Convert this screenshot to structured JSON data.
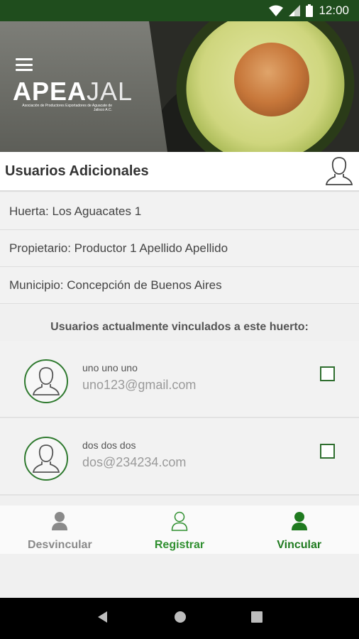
{
  "status_bar": {
    "time": "12:00"
  },
  "header": {
    "logo_main": "APEA",
    "logo_accent": "JAL",
    "logo_subtitle": "Asociación de Productores Exportadores de Aguacate de Jalisco A.C."
  },
  "title_bar": {
    "title": "Usuarios Adicionales"
  },
  "info": {
    "huerta": "Huerta: Los Aguacates 1",
    "propietario": "Propietario: Productor 1 Apellido Apellido",
    "municipio": "Municipio: Concepción de Buenos Aires"
  },
  "linked_users": {
    "label": "Usuarios actualmente vinculados a este huerto:",
    "items": [
      {
        "name": "uno uno uno",
        "email": "uno123@gmail.com",
        "checked": false
      },
      {
        "name": "dos dos dos",
        "email": "dos@234234.com",
        "checked": false
      }
    ]
  },
  "bottom_nav": {
    "items": [
      {
        "label": "Desvincular",
        "color": "#8a8a8a"
      },
      {
        "label": "Registrar",
        "color": "#2f8f2f"
      },
      {
        "label": "Vincular",
        "color": "#1f7a1f"
      }
    ]
  },
  "colors": {
    "status_bar": "#1f4d1d",
    "accent_green": "#2f7a2f"
  }
}
